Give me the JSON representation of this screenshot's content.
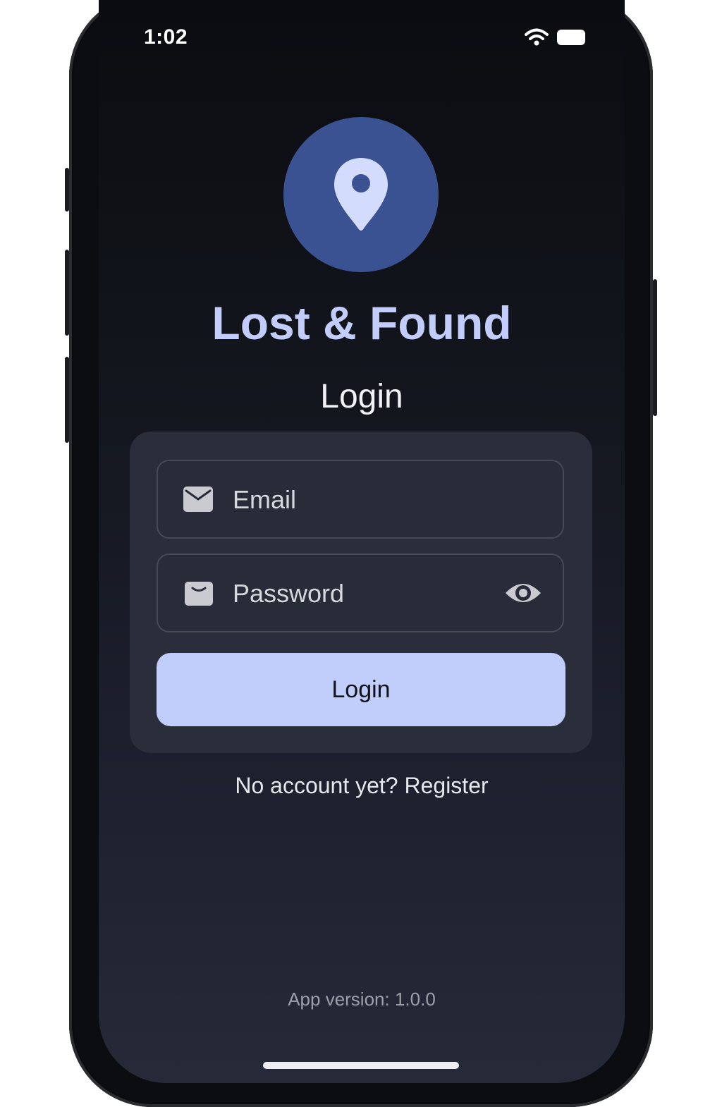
{
  "status_bar": {
    "time": "1:02",
    "wifi_icon": "wifi-icon",
    "battery_icon": "battery-icon"
  },
  "app": {
    "logo_icon": "location-pin-icon",
    "title": "Lost & Found",
    "screen_heading": "Login"
  },
  "form": {
    "email": {
      "icon": "mail-icon",
      "placeholder": "Email",
      "value": ""
    },
    "password": {
      "icon": "lock-icon",
      "placeholder": "Password",
      "value": "",
      "toggle_icon": "eye-icon"
    },
    "submit_label": "Login"
  },
  "register": {
    "prompt": "No account yet?",
    "link_label": "Register"
  },
  "footer": {
    "version": "App version: 1.0.0"
  },
  "colors": {
    "accent": "#c1cdfb",
    "logo_bg": "#3b5292",
    "title": "#c3cdfb",
    "card_bg": "#2a2e3b"
  }
}
